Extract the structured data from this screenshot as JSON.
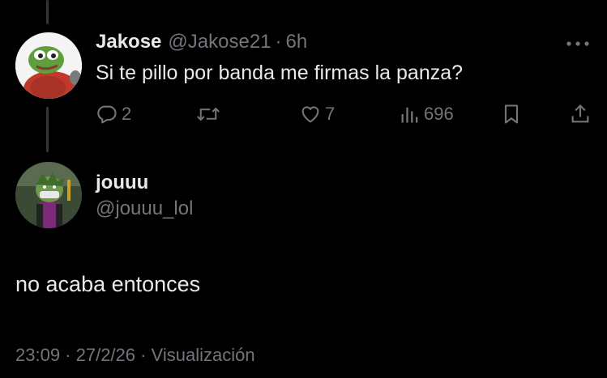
{
  "parent_tweet": {
    "display_name": "Jakose",
    "handle": "@Jakose21",
    "separator": "·",
    "time_ago": "6h",
    "text": "Si te pillo por banda me firmas la panza?",
    "actions": {
      "replies": "2",
      "retweets": "",
      "likes": "7",
      "views": "696"
    },
    "icons": [
      "more-icon",
      "reply-icon",
      "retweet-icon",
      "like-icon",
      "views-icon",
      "bookmark-icon",
      "share-icon"
    ]
  },
  "main_tweet": {
    "display_name": "jouuu",
    "handle": "@jouuu_lol",
    "text": "no acaba entonces",
    "timestamp": "23:09 · 27/2/26 · Visualización"
  },
  "colors": {
    "background": "#000000",
    "text": "#e7e9ea",
    "muted": "#71767b",
    "thread_line": "#333639"
  }
}
